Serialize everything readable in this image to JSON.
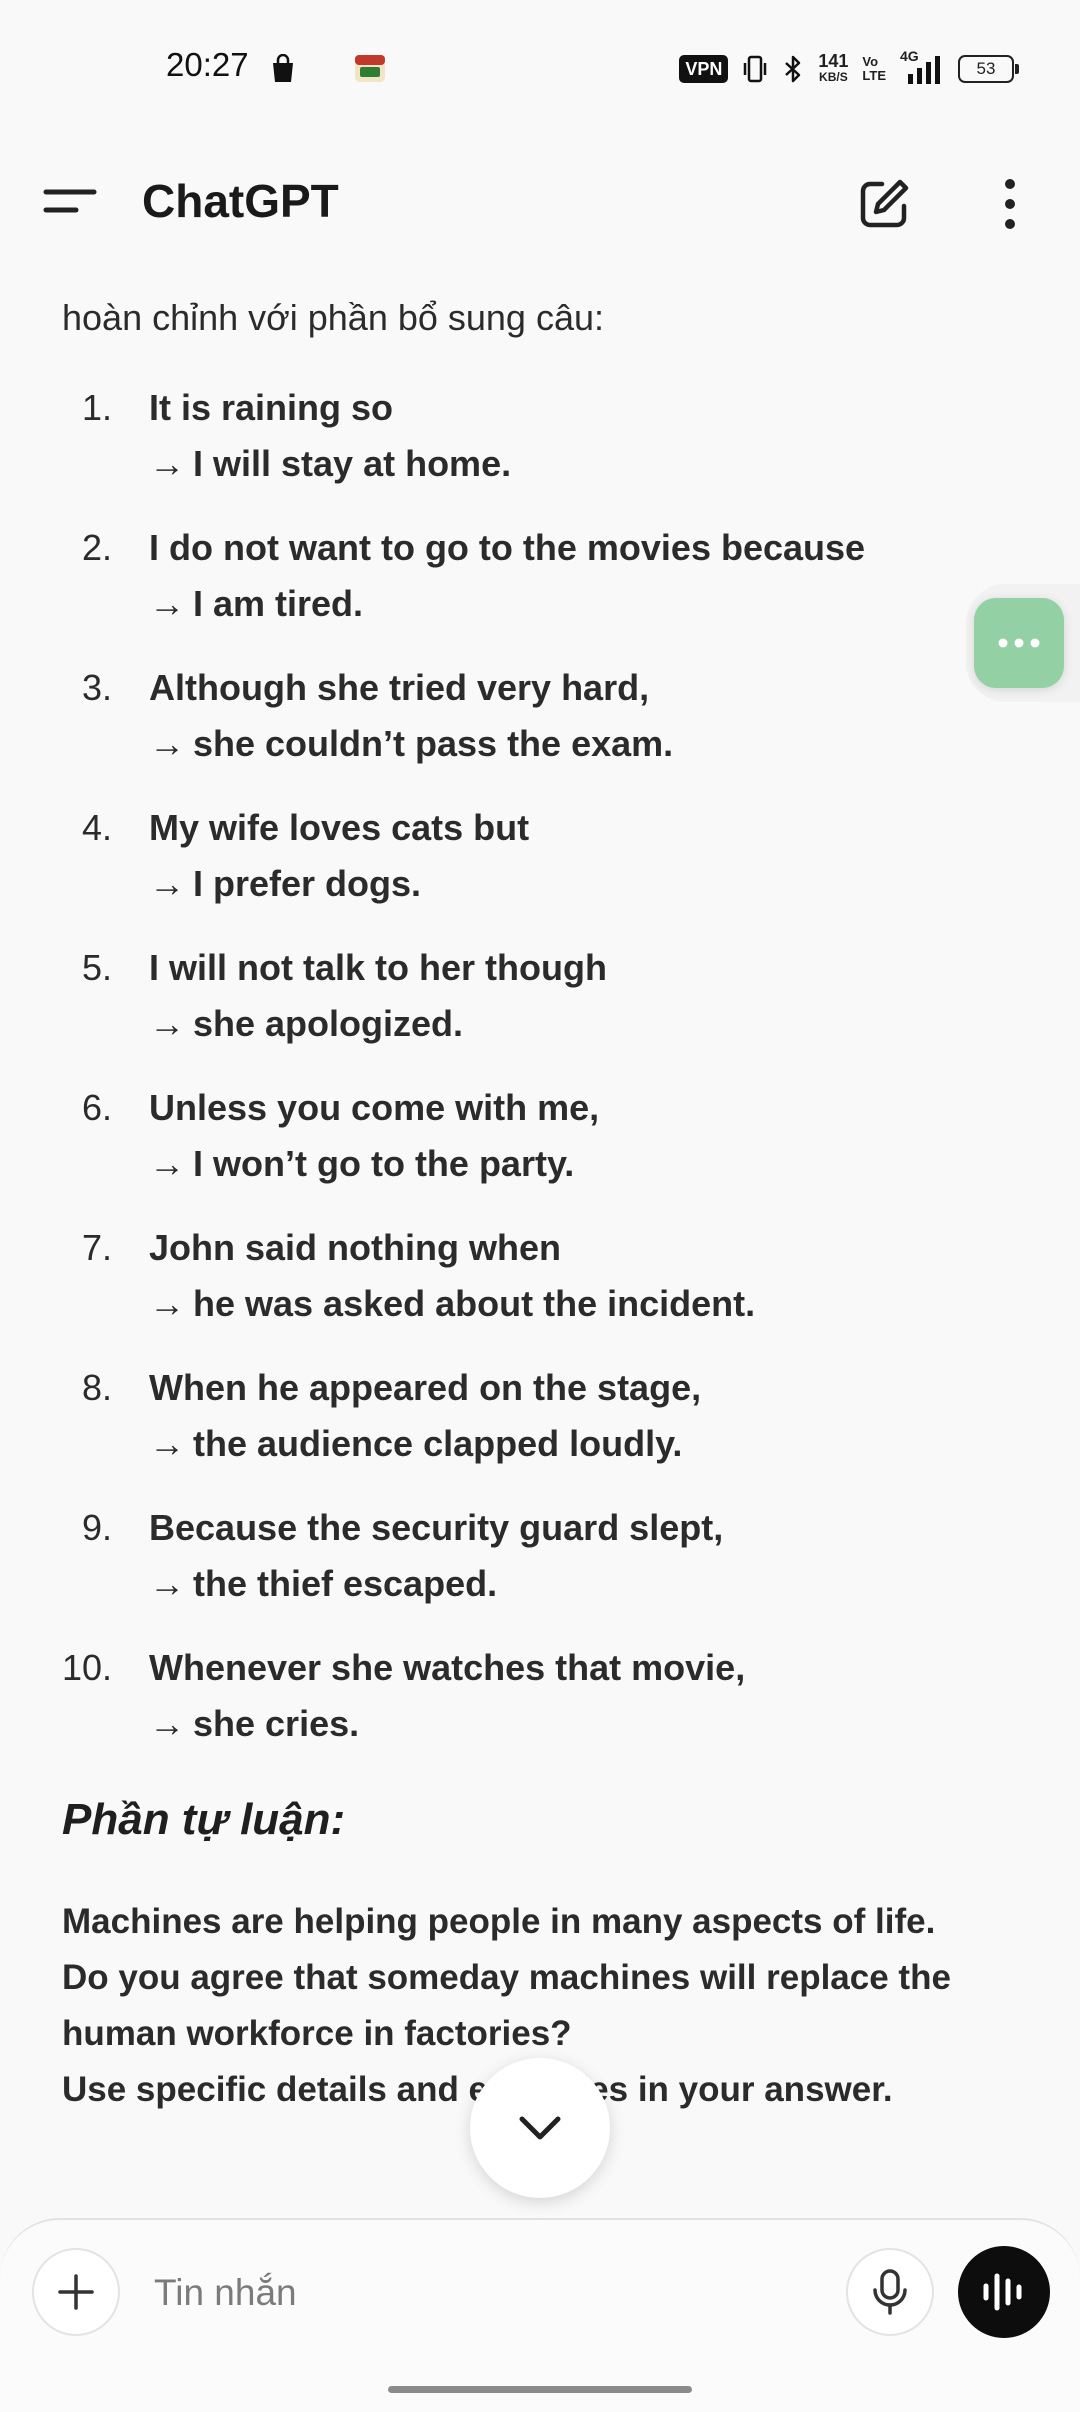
{
  "status_bar": {
    "time": "20:27",
    "vpn": "VPN",
    "net_speed_value": "141",
    "net_speed_unit": "KB/S",
    "volte_top": "Vo",
    "volte_bottom": "LTE",
    "network": "4G",
    "battery": "53"
  },
  "app_bar": {
    "title": "ChatGPT"
  },
  "message": {
    "intro": "hoàn chỉnh với phần bổ sung câu:",
    "items": [
      {
        "num": "1.",
        "first": "It is raining so",
        "second": "I will stay at home."
      },
      {
        "num": "2.",
        "first": "I do not want to go to the movies because",
        "second": "I am tired."
      },
      {
        "num": "3.",
        "first": "Although she tried very hard,",
        "second": "she couldn’t pass the exam."
      },
      {
        "num": "4.",
        "first": "My wife loves cats but",
        "second": "I prefer dogs."
      },
      {
        "num": "5.",
        "first": "I will not talk to her though",
        "second": "she apologized."
      },
      {
        "num": "6.",
        "first": "Unless you come with me,",
        "second": "I won’t go to the party."
      },
      {
        "num": "7.",
        "first": "John said nothing when",
        "second": "he was asked about the incident."
      },
      {
        "num": "8.",
        "first": "When he appeared on the stage,",
        "second": "the audience clapped loudly."
      },
      {
        "num": "9.",
        "first": "Because the security guard slept,",
        "second": "the thief escaped."
      },
      {
        "num": "10.",
        "first": "Whenever she watches that movie,",
        "second": "she cries."
      }
    ],
    "arrow": "→",
    "section_heading": "Phần tự luận:",
    "essay_line1": "Machines are helping people in many aspects of life.",
    "essay_line2": "Do you agree that someday machines will replace the",
    "essay_line3": "human workforce in factories?",
    "essay_line4": "Use specific details and examples in your answer."
  },
  "composer": {
    "placeholder": "Tin nhắn"
  },
  "colors": {
    "background": "#f9f9f9",
    "bubble": "#93d0a4",
    "voice_button": "#0d0d0d"
  },
  "icons": {
    "menu": "menu-icon",
    "compose": "edit-icon",
    "more": "more-vertical-icon",
    "plus": "plus-icon",
    "mic": "microphone-icon",
    "voice": "voice-waveform-icon",
    "scroll": "chevron-down-icon",
    "bubble": "more-horizontal-icon"
  }
}
